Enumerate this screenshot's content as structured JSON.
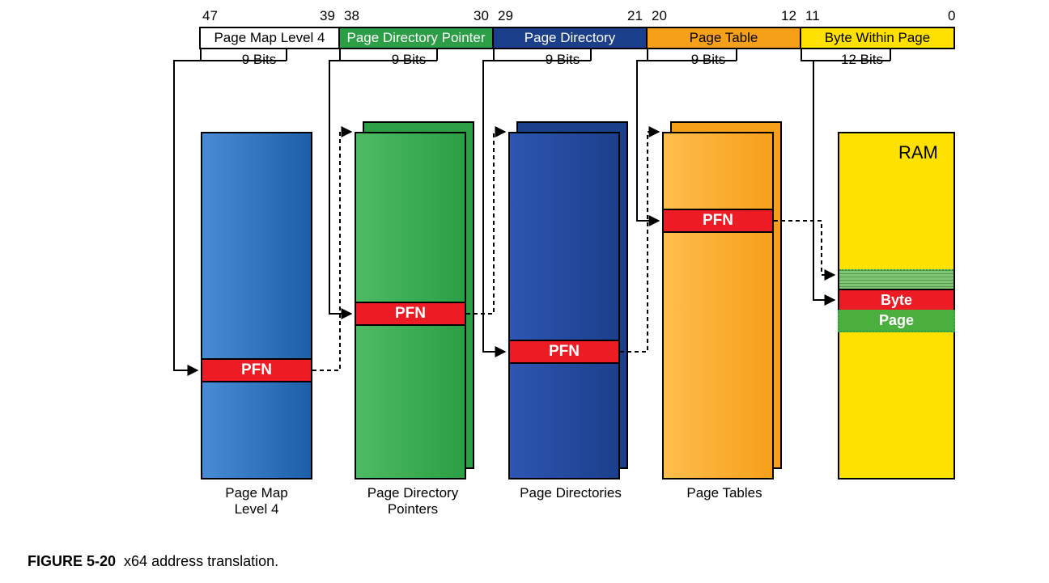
{
  "bits": {
    "b47": "47",
    "b39": "39",
    "b38": "38",
    "b30": "30",
    "b29": "29",
    "b21": "21",
    "b20": "20",
    "b12": "12",
    "b11": "11",
    "b0": "0"
  },
  "segments": {
    "pml4": "Page Map Level 4",
    "pdp": "Page Directory Pointer",
    "pd": "Page Directory",
    "pt": "Page Table",
    "bwp": "Byte Within Page",
    "bits9": "9 Bits",
    "bits12": "12 Bits"
  },
  "pfn": "PFN",
  "ram": {
    "label": "RAM",
    "byte": "Byte",
    "page": "Page"
  },
  "captions": {
    "pml4": "Page Map Level 4",
    "pdp": "Page Directory Pointers",
    "pd": "Page Directories",
    "pt": "Page Tables"
  },
  "figure": {
    "num": "FIGURE 5-20",
    "title": "x64 address translation."
  },
  "colors": {
    "pml4": "#1C5FA8",
    "pml4grad": "#4A8BD6",
    "pdp": "#2C9E46",
    "pdpgrad": "#4DBB63",
    "pd": "#1B3F8B",
    "pt": "#F6A01A",
    "ram": "#FFE100",
    "red": "#ED1C24",
    "pageGreen": "#4BAF3E",
    "pageGreenLt": "#7EC772"
  }
}
